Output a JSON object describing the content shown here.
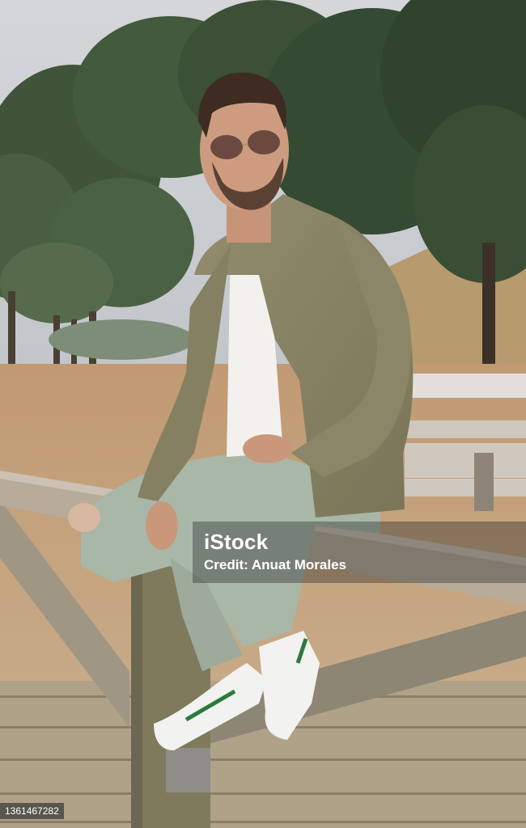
{
  "photo": {
    "subject": "young man in olive denim jacket and sunglasses sitting on a wooden fence",
    "colors": {
      "sky": "#c8ccd2",
      "trees": "#3e5238",
      "ground": "#b58f68",
      "jacket": "#8a8465",
      "jeans": "#a9b6a7",
      "wood": "#a79a86",
      "shoes": "#f2f2f0",
      "shoe_stripe": "#2c7a3a"
    }
  },
  "watermark": {
    "logo_text": "iStock",
    "credit": "Credit: Anuat Morales"
  },
  "image_id": "1361467282"
}
